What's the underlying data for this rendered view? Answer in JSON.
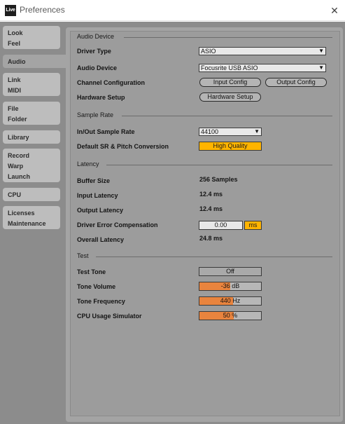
{
  "window": {
    "app_icon": "Live",
    "title": "Preferences",
    "close_icon": "✕"
  },
  "sidebar": {
    "tabs": [
      {
        "lines": [
          "Look",
          "Feel"
        ]
      },
      {
        "lines": [
          "Audio"
        ]
      },
      {
        "lines": [
          "Link",
          "MIDI"
        ]
      },
      {
        "lines": [
          "File",
          "Folder"
        ]
      },
      {
        "lines": [
          "Library"
        ]
      },
      {
        "lines": [
          "Record",
          "Warp",
          "Launch"
        ]
      },
      {
        "lines": [
          "CPU"
        ]
      },
      {
        "lines": [
          "Licenses",
          "Maintenance"
        ]
      }
    ],
    "active_tab": "Audio"
  },
  "audio_device": {
    "section_title": "Audio Device",
    "driver_type_label": "Driver Type",
    "driver_type_value": "ASIO",
    "audio_device_label": "Audio Device",
    "audio_device_value": "Focusrite USB ASIO",
    "channel_config_label": "Channel Configuration",
    "input_config_button": "Input Config",
    "output_config_button": "Output Config",
    "hardware_setup_label": "Hardware Setup",
    "hardware_setup_button": "Hardware Setup",
    "dropdown_arrow": "▼"
  },
  "sample_rate": {
    "section_title": "Sample Rate",
    "in_out_label": "In/Out Sample Rate",
    "in_out_value": "44100",
    "default_sr_label": "Default SR & Pitch Conversion",
    "default_sr_value": "High Quality"
  },
  "latency": {
    "section_title": "Latency",
    "buffer_size_label": "Buffer Size",
    "buffer_size_value": "256 Samples",
    "input_latency_label": "Input Latency",
    "input_latency_value": "12.4 ms",
    "output_latency_label": "Output Latency",
    "output_latency_value": "12.4 ms",
    "driver_error_label": "Driver Error Compensation",
    "driver_error_value": "0.00",
    "driver_error_unit": "ms",
    "overall_latency_label": "Overall Latency",
    "overall_latency_value": "24.8 ms"
  },
  "test": {
    "section_title": "Test",
    "test_tone_label": "Test Tone",
    "test_tone_value": "Off",
    "tone_volume_label": "Tone Volume",
    "tone_volume_value": "-36 dB",
    "tone_volume_fill": 0.5,
    "tone_frequency_label": "Tone Frequency",
    "tone_frequency_value": "440 Hz",
    "tone_frequency_fill": 0.54,
    "cpu_sim_label": "CPU Usage Simulator",
    "cpu_sim_value": "50 %",
    "cpu_sim_fill": 0.56
  },
  "colors": {
    "accent_yellow": "#ffb400",
    "slider_orange": "#e9843e",
    "panel_gray": "#9c9c9c"
  }
}
